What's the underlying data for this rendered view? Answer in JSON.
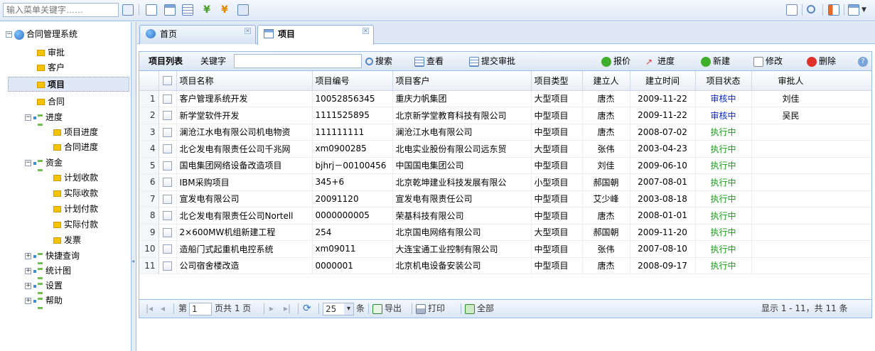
{
  "top_search": {
    "placeholder": "输入菜单关键字……"
  },
  "tree": {
    "root": "合同管理系统",
    "items": [
      {
        "label": "审批"
      },
      {
        "label": "客户"
      },
      {
        "label": "项目",
        "selected": true
      },
      {
        "label": "合同"
      }
    ],
    "groups": [
      {
        "label": "进度",
        "children": [
          "项目进度",
          "合同进度"
        ]
      },
      {
        "label": "资金",
        "children": [
          "计划收款",
          "实际收款",
          "计划付款",
          "实际付款",
          "发票"
        ]
      },
      {
        "label": "快捷查询"
      },
      {
        "label": "统计图"
      },
      {
        "label": "设置"
      },
      {
        "label": "帮助"
      }
    ]
  },
  "tabs": [
    {
      "label": "首页",
      "active": false
    },
    {
      "label": "项目",
      "active": true
    }
  ],
  "gridbar": {
    "title": "项目列表",
    "keyword_label": "关键字",
    "search": "搜索",
    "view": "查看",
    "submit": "提交审批",
    "quote": "报价",
    "progress": "进度",
    "new": "新建",
    "edit": "修改",
    "delete": "删除"
  },
  "columns": [
    "项目名称",
    "项目编号",
    "项目客户",
    "项目类型",
    "建立人",
    "建立时间",
    "项目状态",
    "审批人"
  ],
  "rows": [
    {
      "n": "1",
      "name": "客户管理系统开发",
      "code": "10052856345",
      "client": "重庆力帆集团",
      "type": "大型项目",
      "creator": "唐杰",
      "date": "2009-11-22",
      "status": "审核中",
      "approver": "刘佳"
    },
    {
      "n": "2",
      "name": "新学堂软件开发",
      "code": "1111525895",
      "client": "北京新学堂教育科技有限公司",
      "type": "中型项目",
      "creator": "唐杰",
      "date": "2009-11-22",
      "status": "审核中",
      "approver": "吴民"
    },
    {
      "n": "3",
      "name": "澜沧江水电有限公司机电物资",
      "code": "111111111",
      "client": "澜沧江水电有限公司",
      "type": "中型项目",
      "creator": "唐杰",
      "date": "2008-07-02",
      "status": "执行中",
      "approver": ""
    },
    {
      "n": "4",
      "name": "北仑发电有限责任公司千兆网",
      "code": "xm0900285",
      "client": "北电实业股份有限公司远东贸",
      "type": "大型项目",
      "creator": "张伟",
      "date": "2003-04-23",
      "status": "执行中",
      "approver": ""
    },
    {
      "n": "5",
      "name": "国电集团网络设备改造项目",
      "code": "bjhrj－00100456",
      "client": "中国国电集团公司",
      "type": "中型项目",
      "creator": "刘佳",
      "date": "2009-06-10",
      "status": "执行中",
      "approver": ""
    },
    {
      "n": "6",
      "name": "IBM采购项目",
      "code": "345+6",
      "client": "北京乾坤建业科技发展有限公",
      "type": "小型项目",
      "creator": "郝国朝",
      "date": "2007-08-01",
      "status": "执行中",
      "approver": ""
    },
    {
      "n": "7",
      "name": "宣发电有限公司",
      "code": "20091120",
      "client": "宣发电有限责任公司",
      "type": "中型项目",
      "creator": "艾少峰",
      "date": "2003-08-18",
      "status": "执行中",
      "approver": ""
    },
    {
      "n": "8",
      "name": "北仑发电有限责任公司Nortell",
      "code": "0000000005",
      "client": "荣基科技有限公司",
      "type": "中型项目",
      "creator": "唐杰",
      "date": "2008-01-01",
      "status": "执行中",
      "approver": ""
    },
    {
      "n": "9",
      "name": "2×600MW机组新建工程",
      "code": "254",
      "client": "北京国电网络有限公司",
      "type": "大型项目",
      "creator": "郝国朝",
      "date": "2009-11-20",
      "status": "执行中",
      "approver": ""
    },
    {
      "n": "10",
      "name": "造船门式起重机电控系统",
      "code": "xm09011",
      "client": "大连宝通工业控制有限公司",
      "type": "中型项目",
      "creator": "张伟",
      "date": "2007-08-10",
      "status": "执行中",
      "approver": ""
    },
    {
      "n": "11",
      "name": "公司宿舍楼改造",
      "code": "0000001",
      "client": "北京机电设备安装公司",
      "type": "中型项目",
      "creator": "唐杰",
      "date": "2008-09-17",
      "status": "执行中",
      "approver": ""
    }
  ],
  "pager": {
    "page_prefix": "第",
    "page_value": "1",
    "page_suffix": "页共 1 页",
    "page_size": "25",
    "unit": "条",
    "export": "导出",
    "print": "打印",
    "all": "全部",
    "summary": "显示 1 - 11，共 11 条"
  },
  "colors": {
    "accent": "#99bbe8",
    "reviewing": "#0a28c8",
    "running": "#1a9a1a"
  }
}
